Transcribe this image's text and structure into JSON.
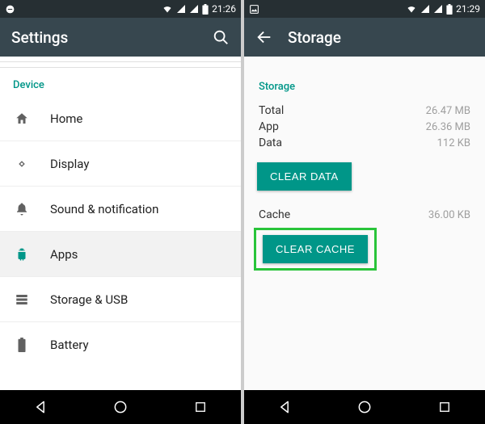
{
  "colors": {
    "accent": "#009688",
    "appbar": "#37474f",
    "highlight": "#29c43a"
  },
  "left": {
    "status": {
      "time": "21:26"
    },
    "appbar": {
      "title": "Settings"
    },
    "section_label": "Device",
    "items": [
      {
        "label": "Home"
      },
      {
        "label": "Display"
      },
      {
        "label": "Sound & notification"
      },
      {
        "label": "Apps"
      },
      {
        "label": "Storage & USB"
      },
      {
        "label": "Battery"
      }
    ]
  },
  "right": {
    "status": {
      "time": "21:29"
    },
    "appbar": {
      "title": "Storage"
    },
    "section_label": "Storage",
    "rows": {
      "total": {
        "label": "Total",
        "value": "26.47 MB"
      },
      "app": {
        "label": "App",
        "value": "26.36 MB"
      },
      "data": {
        "label": "Data",
        "value": "112 KB"
      },
      "cache": {
        "label": "Cache",
        "value": "36.00 KB"
      }
    },
    "buttons": {
      "clear_data": "CLEAR DATA",
      "clear_cache": "CLEAR CACHE"
    }
  }
}
